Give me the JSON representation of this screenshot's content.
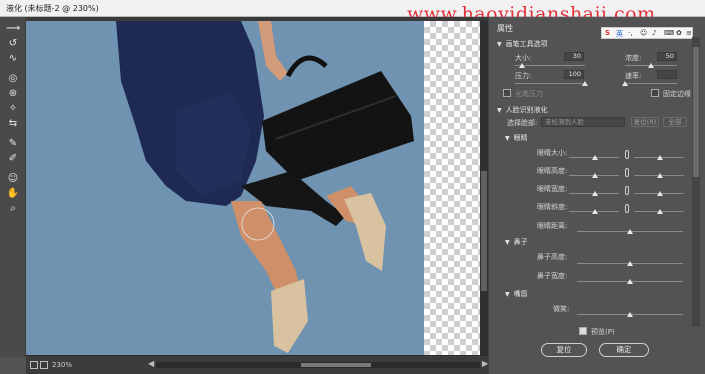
{
  "window": {
    "title": "液化 (未标题-2 @ 230%)"
  },
  "watermark": "www.haoyidianshaji.com",
  "toolbar": {
    "tools": [
      {
        "name": "forward-warp-tool",
        "glyph": "⟿"
      },
      {
        "name": "reconstruct-tool",
        "glyph": "↺"
      },
      {
        "name": "smooth-tool",
        "glyph": "∿"
      },
      {
        "name": "twirl-tool",
        "glyph": "◎"
      },
      {
        "name": "pucker-tool",
        "glyph": "⊛"
      },
      {
        "name": "bloat-tool",
        "glyph": "✧"
      },
      {
        "name": "push-left-tool",
        "glyph": "⇆"
      },
      {
        "name": "freeze-mask-tool",
        "glyph": "✎"
      },
      {
        "name": "thaw-mask-tool",
        "glyph": "✐"
      },
      {
        "name": "face-tool",
        "glyph": "☺"
      },
      {
        "name": "hand-tool",
        "glyph": "✋"
      },
      {
        "name": "zoom-tool",
        "glyph": "⌕"
      }
    ]
  },
  "status": {
    "zoom": "230%"
  },
  "ime": {
    "logo": "S",
    "lang": "英"
  },
  "panel": {
    "title": "属性",
    "brush_section": "画笔工具选项",
    "brush": {
      "size_label": "大小:",
      "size_value": "30",
      "density_label": "浓度:",
      "density_value": "50",
      "size_level": 0.1,
      "density_level": 0.5,
      "pressure_label": "压力:",
      "pressure_value": "100",
      "rate_label": "速率:",
      "rate_value": "",
      "pressure_level": 1.0,
      "rate_level": 0.0,
      "stylus_label": "光笔压力",
      "pin_edges_label": "固定边缘"
    },
    "face_section": "人脸识别液化",
    "face": {
      "select_label": "选择脸部:",
      "select_value": "未检测到人脸",
      "reset_label": "复位(R)",
      "all_label": "全部"
    },
    "eyes_section": "眼睛",
    "eyes": [
      "眼睛大小:",
      "眼睛高度:",
      "眼睛宽度:",
      "眼睛斜度:",
      "眼睛距离:"
    ],
    "nose_section": "鼻子",
    "nose": [
      "鼻子高度:",
      "鼻子宽度:"
    ],
    "mouth_section": "嘴唇",
    "mouth": [
      "微笑:"
    ],
    "preview_label": "预览(P)",
    "reset_button": "复位",
    "ok_button": "确定"
  }
}
